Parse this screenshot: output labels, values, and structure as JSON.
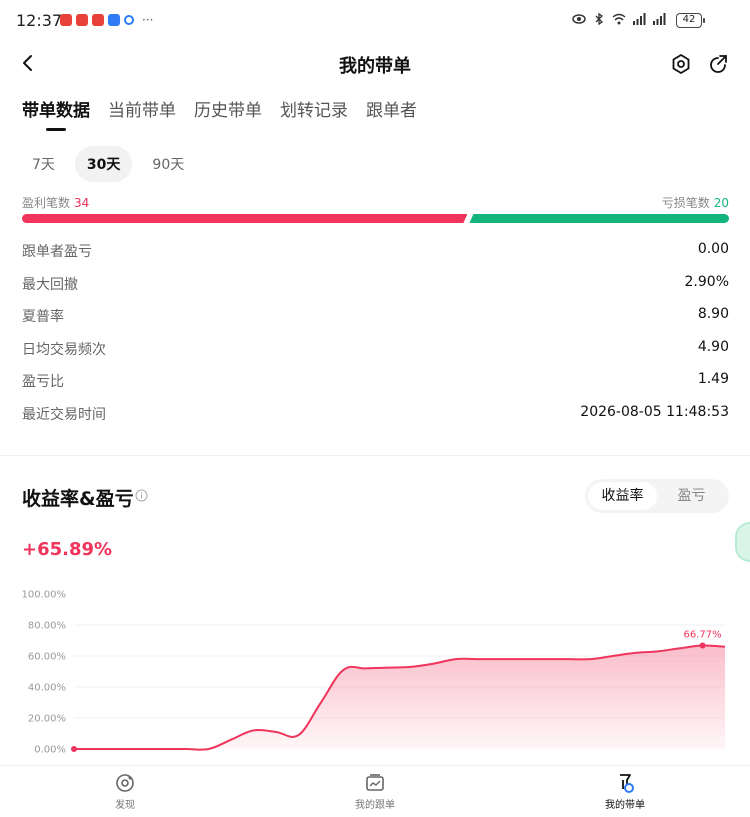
{
  "status_bar": {
    "time": "12:37",
    "more": "···",
    "battery": "42"
  },
  "header": {
    "title": "我的带单"
  },
  "tabs": [
    {
      "label": "带单数据",
      "active": true
    },
    {
      "label": "当前带单",
      "active": false
    },
    {
      "label": "历史带单",
      "active": false
    },
    {
      "label": "划转记录",
      "active": false
    },
    {
      "label": "跟单者",
      "active": false
    }
  ],
  "periods": [
    {
      "label": "7天",
      "active": false
    },
    {
      "label": "30天",
      "active": true
    },
    {
      "label": "90天",
      "active": false
    }
  ],
  "win_loss": {
    "win_label": "盈利笔数",
    "win_count": "34",
    "loss_label": "亏损笔数",
    "loss_count": "20",
    "win_fraction": 0.63
  },
  "stats": [
    {
      "label": "跟单者盈亏",
      "value": "0.00"
    },
    {
      "label": "最大回撤",
      "value": "2.90%"
    },
    {
      "label": "夏普率",
      "value": "8.90"
    },
    {
      "label": "日均交易频次",
      "value": "4.90"
    },
    {
      "label": "盈亏比",
      "value": "1.49"
    },
    {
      "label": "最近交易时间",
      "value": "2026-08-05 11:48:53"
    }
  ],
  "chart_section": {
    "title": "收益率&盈亏",
    "toggle": [
      {
        "label": "收益率",
        "active": true
      },
      {
        "label": "盈亏",
        "active": false
      }
    ],
    "total_return": "+65.89%"
  },
  "colors": {
    "profit": "#f0345c",
    "loss": "#13b57d",
    "text": "#111111"
  },
  "chart_data": {
    "type": "area",
    "x": [
      0,
      1,
      2,
      3,
      4,
      5,
      6,
      7,
      8,
      9,
      10,
      11,
      12,
      13,
      14,
      15,
      16,
      17,
      18,
      19,
      20,
      21,
      22,
      23,
      24,
      25,
      26,
      27,
      28,
      29
    ],
    "series": [
      {
        "values": [
          0,
          0,
          0,
          0,
          0,
          0,
          0,
          6,
          12,
          11,
          9,
          30,
          51,
          52,
          52.5,
          53,
          55,
          58,
          58,
          58,
          58,
          58,
          58,
          58,
          60,
          62,
          63,
          65,
          66.77,
          66
        ]
      }
    ],
    "y_ticks": [
      "100.00%",
      "80.00%",
      "60.00%",
      "40.00%",
      "20.00%",
      "0.00%"
    ],
    "ylim": [
      0,
      100
    ],
    "annotation": {
      "index": 28,
      "text": "66.77%"
    },
    "grid": true
  },
  "bottom_nav": [
    {
      "label": "发现",
      "icon": "discover-icon",
      "active": false
    },
    {
      "label": "我的跟单",
      "icon": "copy-chart-icon",
      "active": false
    },
    {
      "label": "我的带单",
      "icon": "lead-trader-icon",
      "active": true
    }
  ]
}
